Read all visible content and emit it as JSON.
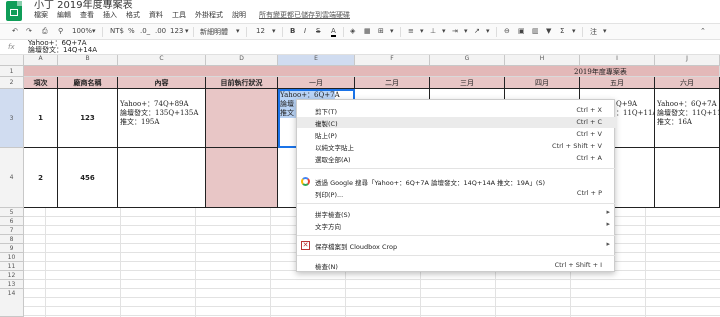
{
  "app": {
    "title": "小丁 2019年度專案表",
    "menu": [
      "檔案",
      "編輯",
      "查看",
      "插入",
      "格式",
      "資料",
      "工具",
      "外掛程式",
      "說明"
    ],
    "saved_status": "所有變更都已儲存到雲端硬碟"
  },
  "toolbar": {
    "zoom": "100%",
    "currency": "NT$",
    "percent": "%",
    "decimal_less": ".0_",
    "decimal_more": ".00",
    "format_more": "123",
    "font": "新細明體",
    "font_size": "12"
  },
  "formula_bar": {
    "label": "fx",
    "line1": "Yahoo+：6Q+7A",
    "line2": "論壇發文：14Q+14A"
  },
  "columns": [
    "A",
    "B",
    "C",
    "D",
    "E",
    "F",
    "G",
    "H",
    "I",
    "J"
  ],
  "rows": [
    "1",
    "2",
    "3",
    "4",
    "5",
    "6",
    "7",
    "8",
    "9",
    "10",
    "11",
    "12",
    "13",
    "14"
  ],
  "sheet": {
    "year_title": "2019年度專案表",
    "headers": [
      "項次",
      "廠商名稱",
      "內容",
      "目前執行狀況",
      "一月",
      "二月",
      "三月",
      "四月",
      "五月",
      "六月"
    ],
    "row3": {
      "no": "1",
      "vendor": "123",
      "content": [
        "Yahoo+：74Q+89A",
        "論壇發文：135Q+135A",
        "推文：195A"
      ],
      "jan": [
        "Yahoo+：6Q+7A",
        "論壇",
        "推文"
      ],
      "may": [
        "Q+9A",
        "：11Q+11A"
      ],
      "jun": [
        "Yahoo+：6Q+7A",
        "論壇發文：11Q+11A",
        "推文：16A"
      ]
    },
    "row4": {
      "no": "2",
      "vendor": "456"
    }
  },
  "context_menu": {
    "items": [
      {
        "label": "剪下(T)",
        "shortcut": "Ctrl + X"
      },
      {
        "label": "複製(C)",
        "shortcut": "Ctrl + C"
      },
      {
        "label": "貼上(P)",
        "shortcut": "Ctrl + V"
      },
      {
        "label": "以純文字貼上",
        "shortcut": "Ctrl + Shift + V"
      },
      {
        "label": "選取全部(A)",
        "shortcut": "Ctrl + A"
      },
      {
        "label": "透過 Google 搜尋「Yahoo+：6Q+7A 論壇發文：14Q+14A 推文：19A」(S)",
        "shortcut": ""
      },
      {
        "label": "列印(P)...",
        "shortcut": "Ctrl + P"
      },
      {
        "label": "拼字檢查(S)",
        "shortcut": ""
      },
      {
        "label": "文字方向",
        "shortcut": ""
      },
      {
        "label": "保存檔案到 Cloudbox Crop",
        "shortcut": ""
      },
      {
        "label": "檢查(N)",
        "shortcut": "Ctrl + Shift + I"
      }
    ]
  }
}
